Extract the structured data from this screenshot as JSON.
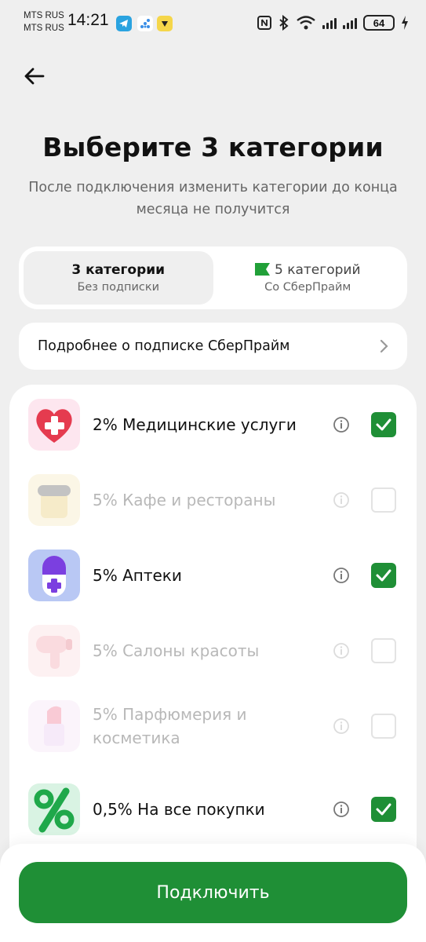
{
  "status_bar": {
    "carrier_1": "MTS RUS",
    "carrier_2": "MTS RUS",
    "time": "14:21",
    "battery": "64"
  },
  "header": {
    "title": "Выберите 3 категории",
    "subtitle": "После подключения изменить категории до конца месяца не получится"
  },
  "tabs": [
    {
      "label": "3 категории",
      "sub": "Без подписки",
      "active": true
    },
    {
      "label": "5 категорий",
      "sub": "Со СберПрайм",
      "active": false
    }
  ],
  "more_link": {
    "label": "Подробнее о подписке СберПрайм"
  },
  "categories": [
    {
      "label": "2% Медицинские услуги",
      "selected": true,
      "icon": "heart-medical-icon"
    },
    {
      "label": "5% Кафе и рестораны",
      "selected": false,
      "icon": "coffee-cup-icon"
    },
    {
      "label": "5% Аптеки",
      "selected": true,
      "icon": "pill-icon"
    },
    {
      "label": "5% Салоны красоты",
      "selected": false,
      "icon": "hair-dryer-icon"
    },
    {
      "label": "5% Парфюмерия и косметика",
      "selected": false,
      "icon": "lipstick-icon"
    },
    {
      "label": "0,5% На все покупки",
      "selected": true,
      "icon": "percent-icon"
    }
  ],
  "colors": {
    "accent": "#1f8f36",
    "background": "#efefef"
  },
  "connect_button": {
    "label": "Подключить"
  }
}
